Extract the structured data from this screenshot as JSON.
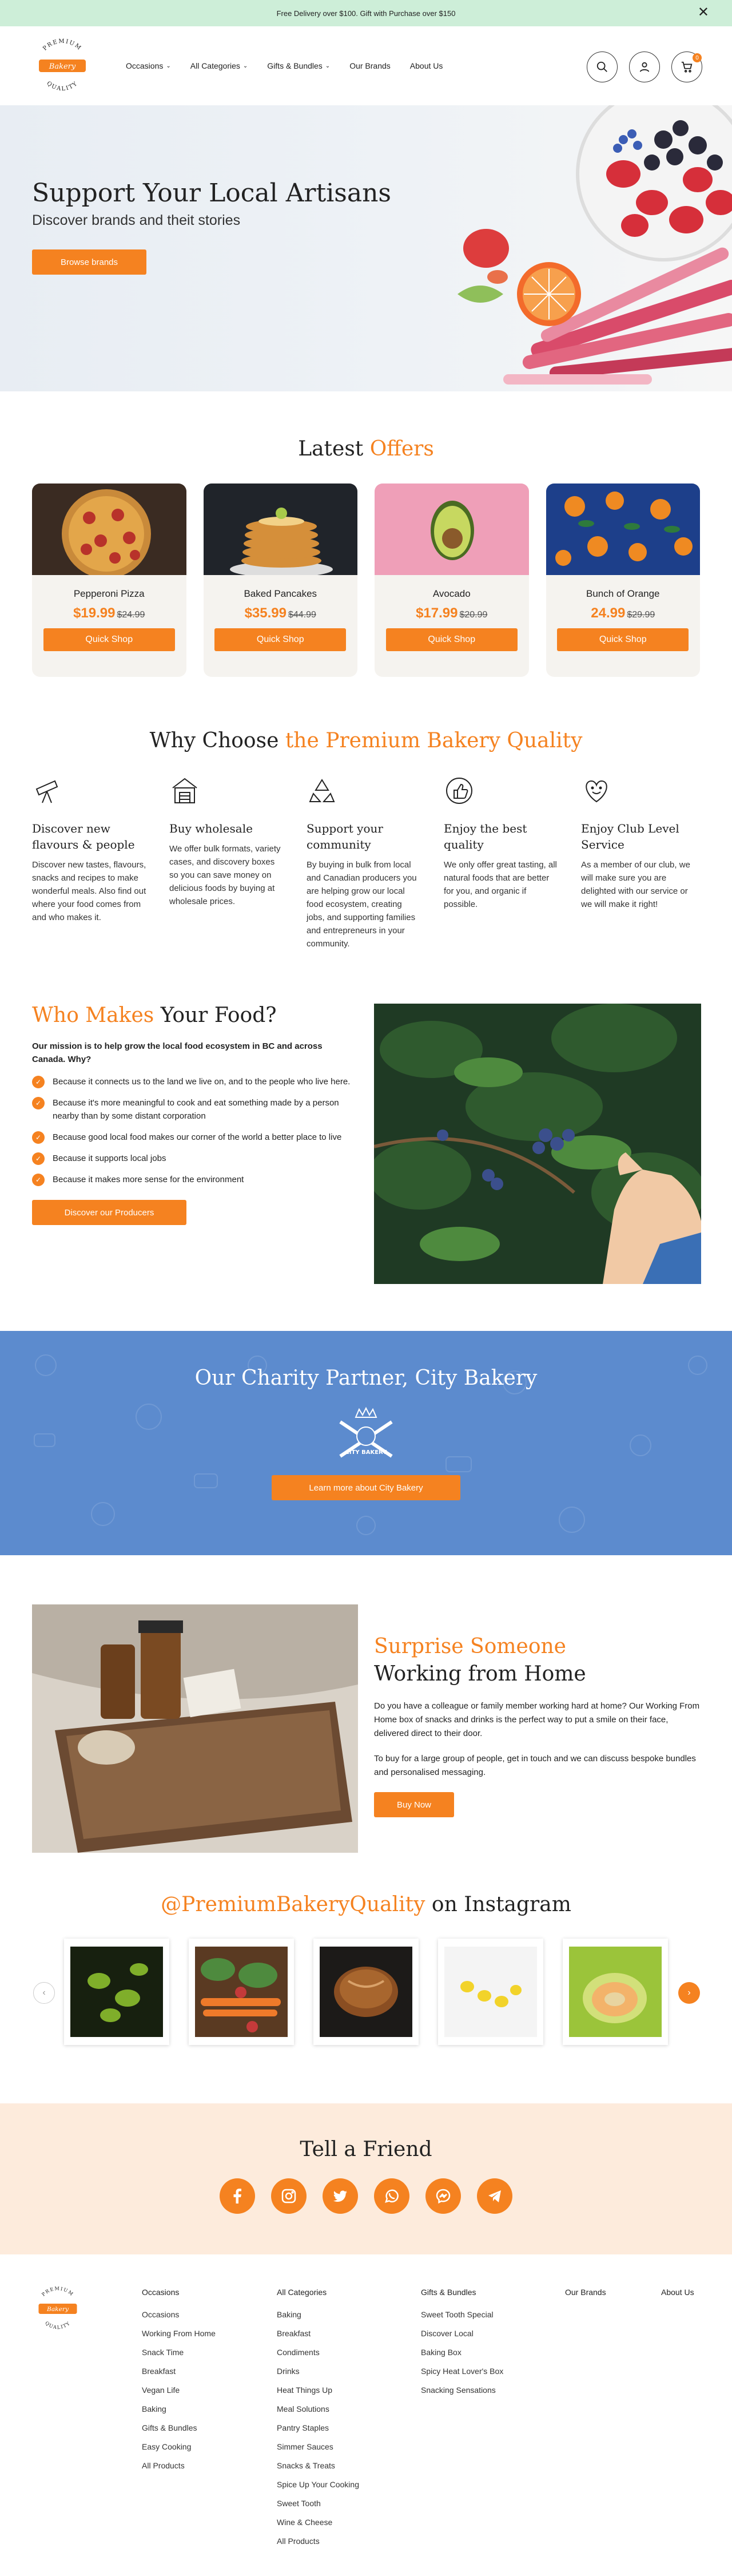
{
  "announcement": {
    "text": "Free Delivery over $100. Gift with Purchase over $150"
  },
  "logo": {
    "top_text": "PREMIUM",
    "middle_text": "Bakery",
    "bottom_text": "QUALITY"
  },
  "nav": {
    "items": [
      {
        "label": "Occasions",
        "dropdown": true
      },
      {
        "label": "All Categories",
        "dropdown": true
      },
      {
        "label": "Gifts & Bundles",
        "dropdown": true
      },
      {
        "label": "Our Brands",
        "dropdown": false
      },
      {
        "label": "About Us",
        "dropdown": false
      }
    ]
  },
  "cart": {
    "count": "0"
  },
  "hero": {
    "title": "Support Your Local Artisans",
    "subtitle": "Discover brands and theit stories",
    "button": "Browse brands"
  },
  "offers": {
    "title_plain": "Latest",
    "title_accent": "Offers",
    "items": [
      {
        "name": "Pepperoni Pizza",
        "price": "$19.99",
        "was": "$24.99",
        "button": "Quick Shop"
      },
      {
        "name": "Baked Pancakes",
        "price": "$35.99",
        "was": "$44.99",
        "button": "Quick Shop"
      },
      {
        "name": "Avocado",
        "price": "$17.99",
        "was": "$20.99",
        "button": "Quick Shop"
      },
      {
        "name": "Bunch of Orange",
        "price": "24.99",
        "was": "$29.99",
        "button": "Quick Shop"
      }
    ]
  },
  "why": {
    "title_plain": "Why Choose",
    "title_accent": "the Premium Bakery Quality",
    "items": [
      {
        "icon": "telescope-icon",
        "title": "Discover new flavours & people",
        "text": "Discover new tastes, flavours, snacks and recipes to make wonderful meals. Also find out where your food comes from and who makes it."
      },
      {
        "icon": "store-icon",
        "title": "Buy wholesale",
        "text": "We offer bulk formats, variety cases, and discovery boxes so you can save money on delicious foods by buying at wholesale prices."
      },
      {
        "icon": "recycle-icon",
        "title": "Support your community",
        "text": "By buying in bulk from local and Canadian producers you are helping grow our local food ecosystem, creating jobs, and supporting families and entrepreneurs in your community."
      },
      {
        "icon": "thumbs-up-icon",
        "title": "Enjoy the best quality",
        "text": "We only offer great tasting, all natural foods that are better for you, and organic if possible."
      },
      {
        "icon": "heart-smile-icon",
        "title": "Enjoy Club Level Service",
        "text": "As a member of our club, we will make sure you are delighted with our service or we will make it right!"
      }
    ]
  },
  "who": {
    "title_accent": "Who Makes",
    "title_plain": "Your Food?",
    "intro": "Our mission is to help grow the local food ecosystem in BC and across Canada.  Why?",
    "reasons": [
      "Because it connects us to the land we live on, and to the people who live here.",
      "Because it's more meaningful to cook and eat something made by a person nearby than by some distant corporation",
      "Because good local food makes our corner of the world a better place to live",
      "Because it supports local jobs",
      "Because it makes more sense for the environment"
    ],
    "button": "Discover our Producers"
  },
  "charity": {
    "title": "Our Charity Partner, City Bakery",
    "logo_text": "CITY BAKERY",
    "button": "Learn more about City Bakery"
  },
  "surprise": {
    "title_accent": "Surprise Someone",
    "title_plain": "Working from Home",
    "para1": "Do you have a colleague or family member working hard at home? Our Working From Home box of snacks and drinks is the perfect way to put a smile on their face, delivered direct to their door.",
    "para2": "To buy for a large group of people, get in touch and we can discuss bespoke bundles and personalised messaging.",
    "button": "Buy Now"
  },
  "instagram": {
    "handle": "@PremiumBakeryQuality",
    "suffix": "on Instagram",
    "prev": "‹",
    "next": "›"
  },
  "tell": {
    "title": "Tell a Friend",
    "networks": [
      "facebook-icon",
      "instagram-icon",
      "twitter-icon",
      "whatsapp-icon",
      "messenger-icon",
      "telegram-icon"
    ]
  },
  "footer": {
    "columns": [
      {
        "title": "Occasions",
        "links": [
          "Occasions",
          "Working From Home",
          "Snack Time",
          "Breakfast",
          "Vegan Life",
          "Baking",
          "Gifts & Bundles",
          "Easy Cooking",
          "All Products"
        ]
      },
      {
        "title": "All Categories",
        "links": [
          "Baking",
          "Breakfast",
          "Condiments",
          "Drinks",
          "Heat Things Up",
          "Meal Solutions",
          "Pantry Staples",
          "Simmer Sauces",
          "Snacks & Treats",
          "Spice Up Your Cooking",
          "Sweet Tooth",
          "Wine & Cheese",
          "All Products"
        ]
      },
      {
        "title": "Gifts & Bundles",
        "links": [
          "Sweet Tooth Special",
          "Discover Local",
          "Baking Box",
          "Spicy Heat Lover's Box",
          "Snacking Sensations"
        ]
      },
      {
        "title": "Our Brands",
        "links": []
      },
      {
        "title": "About Us",
        "links": []
      }
    ]
  },
  "colors": {
    "accent": "#f58220",
    "topbar": "#cdeed8",
    "charity_bg": "#5c8bce",
    "tell_bg": "#fdebdc",
    "card_bg": "#f5f3ef"
  }
}
